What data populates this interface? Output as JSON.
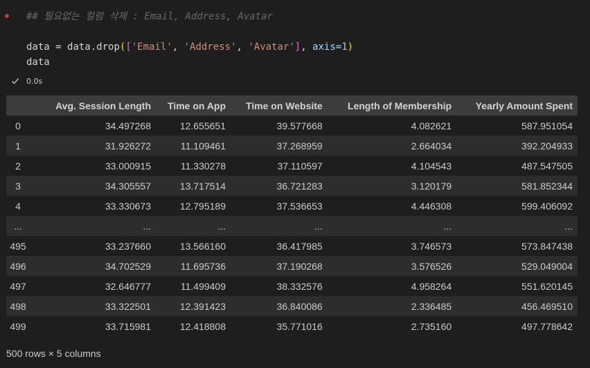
{
  "code": {
    "comment": "## 필요없는 컬럼 삭제 : Email, Address, Avatar",
    "line1": {
      "var": "data",
      "op": " = ",
      "obj": "data.drop",
      "lparen": "(",
      "lbracket": "[",
      "str1": "'Email'",
      "sep1": ", ",
      "str2": "'Address'",
      "sep2": ", ",
      "str3": "'Avatar'",
      "rbracket": "]",
      "sep3": ", ",
      "kw": "axis=",
      "num": "1",
      "rparen": ")"
    },
    "line2": "data"
  },
  "status": {
    "icon": "check-icon",
    "time": "0.0s"
  },
  "table": {
    "columns": [
      "",
      "Avg. Session Length",
      "Time on App",
      "Time on Website",
      "Length of Membership",
      "Yearly Amount Spent"
    ],
    "rows": [
      [
        "0",
        "34.497268",
        "12.655651",
        "39.577668",
        "4.082621",
        "587.951054"
      ],
      [
        "1",
        "31.926272",
        "11.109461",
        "37.268959",
        "2.664034",
        "392.204933"
      ],
      [
        "2",
        "33.000915",
        "11.330278",
        "37.110597",
        "4.104543",
        "487.547505"
      ],
      [
        "3",
        "34.305557",
        "13.717514",
        "36.721283",
        "3.120179",
        "581.852344"
      ],
      [
        "4",
        "33.330673",
        "12.795189",
        "37.536653",
        "4.446308",
        "599.406092"
      ],
      [
        "...",
        "...",
        "...",
        "...",
        "...",
        "..."
      ],
      [
        "495",
        "33.237660",
        "13.566160",
        "36.417985",
        "3.746573",
        "573.847438"
      ],
      [
        "496",
        "34.702529",
        "11.695736",
        "37.190268",
        "3.576526",
        "529.049004"
      ],
      [
        "497",
        "32.646777",
        "11.499409",
        "38.332576",
        "4.958264",
        "551.620145"
      ],
      [
        "498",
        "33.322501",
        "12.391423",
        "36.840086",
        "2.336485",
        "456.469510"
      ],
      [
        "499",
        "33.715981",
        "12.418808",
        "35.771016",
        "2.735160",
        "497.778642"
      ]
    ]
  },
  "footer": "500 rows × 5 columns",
  "colors": {
    "background": "#1e1e1e",
    "header_bg": "#3c3c3c",
    "stripe_bg": "#2d2d2d",
    "string": "#ce9178",
    "keyword": "#9cdcfe",
    "number": "#b5cea8",
    "paren": "#ffd700",
    "bracket": "#da70d6",
    "success": "#89d185",
    "dot": "#c13c3c"
  }
}
